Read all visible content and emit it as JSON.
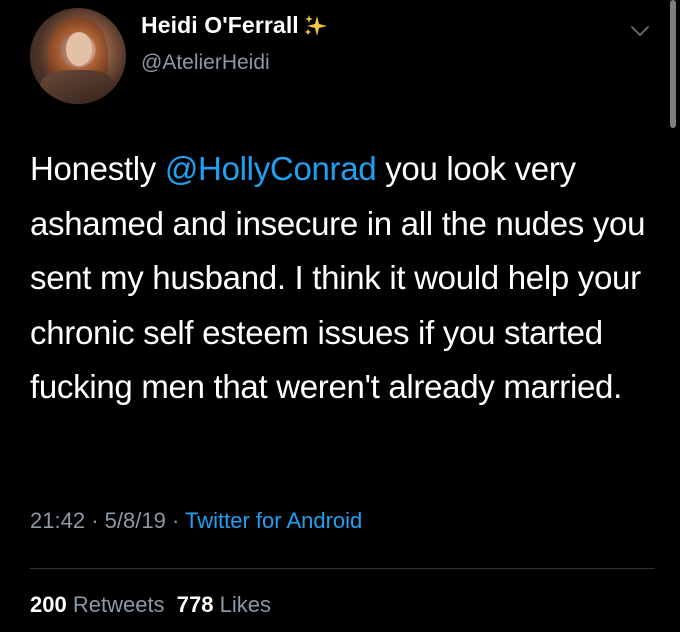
{
  "tweet": {
    "author": {
      "name": "Heidi O'Ferrall",
      "name_emoji_icon": "sparkles-icon",
      "handle": "@AtelierHeidi",
      "avatar_icon": "avatar"
    },
    "text": {
      "part1": "Honestly ",
      "mention": "@HollyConrad",
      "part2": " you look very ashamed and insecure in all the nudes you sent my husband. I think it would help your chronic self esteem issues if you started fucking men that weren't already married."
    },
    "time": "21:42",
    "separator": "·",
    "date": "5/8/19",
    "source": "Twitter for Android",
    "retweets_count": "200",
    "retweets_label": "Retweets",
    "likes_count": "778",
    "likes_label": "Likes"
  },
  "colors": {
    "background": "#000000",
    "text": "#ffffff",
    "secondary": "#8b98a5",
    "accent": "#1da1f2",
    "sparkle": "#f5c542"
  },
  "menu": {
    "icon": "chevron-down-icon"
  }
}
